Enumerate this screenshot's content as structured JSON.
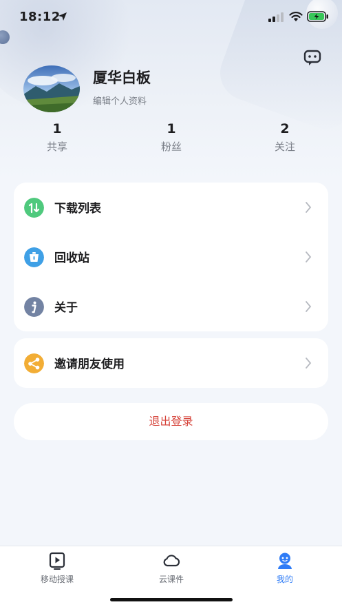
{
  "status_bar": {
    "time": "18:12"
  },
  "profile": {
    "name": "厦华白板",
    "edit_link": "编辑个人资料"
  },
  "stats": [
    {
      "value": "1",
      "label": "共享"
    },
    {
      "value": "1",
      "label": "粉丝"
    },
    {
      "value": "2",
      "label": "关注"
    }
  ],
  "menu": {
    "items": [
      {
        "label": "下载列表",
        "icon": "download-list-icon",
        "color": "#3fbf6f"
      },
      {
        "label": "回收站",
        "icon": "recycle-bin-icon",
        "color": "#3a9be0"
      },
      {
        "label": "关于",
        "icon": "info-icon",
        "color": "#6f7f9e"
      }
    ],
    "invite": {
      "label": "邀请朋友使用",
      "icon": "share-icon",
      "color": "#f0a92e"
    }
  },
  "logout_label": "退出登录",
  "tabs": [
    {
      "label": "移动授课",
      "icon": "play-board-icon",
      "active": false
    },
    {
      "label": "云课件",
      "icon": "cloud-icon",
      "active": false
    },
    {
      "label": "我的",
      "icon": "profile-icon",
      "active": true
    }
  ],
  "colors": {
    "accent": "#2f7cf6",
    "logout": "#d6443b"
  }
}
